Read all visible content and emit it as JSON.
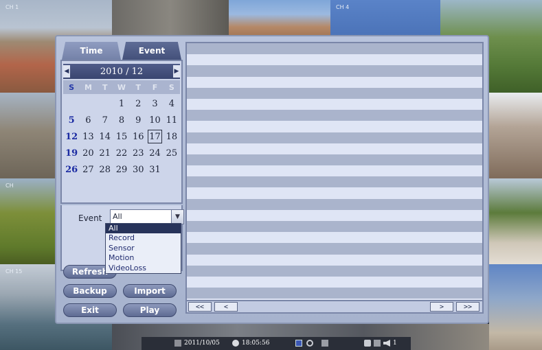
{
  "background": {
    "channel_labels": [
      "CH 1",
      "CH 4",
      "CH",
      "CH 15"
    ]
  },
  "tabs": [
    {
      "label": "Time"
    },
    {
      "label": "Event"
    }
  ],
  "calendar": {
    "month_title": "2010 / 12",
    "weekdays": [
      "S",
      "M",
      "T",
      "W",
      "T",
      "F",
      "S"
    ],
    "days": [
      "",
      "",
      "",
      "1",
      "2",
      "3",
      "4",
      "5",
      "6",
      "7",
      "8",
      "9",
      "10",
      "11",
      "12",
      "13",
      "14",
      "15",
      "16",
      "17",
      "18",
      "19",
      "20",
      "21",
      "22",
      "23",
      "24",
      "25",
      "26",
      "27",
      "28",
      "29",
      "30",
      "31",
      ""
    ],
    "selected_day": "17"
  },
  "event_filter": {
    "label": "Event",
    "value": "All",
    "options": [
      "All",
      "Record",
      "Sensor",
      "Motion",
      "VideoLoss"
    ]
  },
  "buttons": {
    "refresh": "Refresh",
    "backup": "Backup",
    "import": "Import",
    "exit": "Exit",
    "play": "Play"
  },
  "list_nav": {
    "first": "<<",
    "prev": "<",
    "next": ">",
    "last": ">>"
  },
  "status_bar": {
    "date": "2011/10/05",
    "time": "18:05:56",
    "volume": "1"
  },
  "colors": {
    "accent_dark": "#27335a",
    "sunday": "#1a2aa2"
  }
}
